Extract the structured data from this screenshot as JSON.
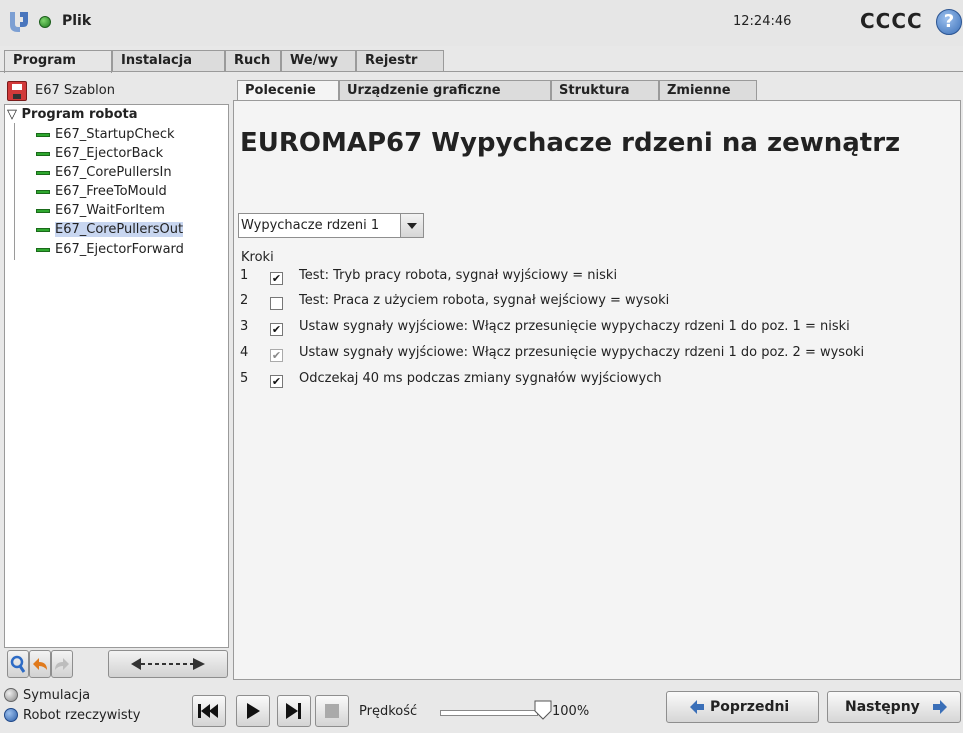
{
  "topbar": {
    "file_label": "Plik",
    "clock": "12:24:46",
    "robot_name": "CCCC",
    "help": "?"
  },
  "main_tabs": [
    {
      "label": "Program"
    },
    {
      "label": "Instalacja"
    },
    {
      "label": "Ruch"
    },
    {
      "label": "We/wy"
    },
    {
      "label": "Rejestr"
    }
  ],
  "sidebar": {
    "template_label": "E67 Szablon",
    "tree_root": "Program robota",
    "items": [
      {
        "label": "E67_StartupCheck"
      },
      {
        "label": "E67_EjectorBack"
      },
      {
        "label": "E67_CorePullersIn"
      },
      {
        "label": "E67_FreeToMould"
      },
      {
        "label": "E67_WaitForItem"
      },
      {
        "label": "E67_CorePullersOut"
      },
      {
        "label": "E67_EjectorForward"
      }
    ]
  },
  "sub_tabs": [
    {
      "label": "Polecenie"
    },
    {
      "label": "Urządzenie graficzne"
    },
    {
      "label": "Struktura"
    },
    {
      "label": "Zmienne"
    }
  ],
  "main": {
    "title": "EUROMAP67 Wypychacze rdzeni na zewnątrz",
    "dropdown_value": "Wypychacze rdzeni 1",
    "steps_label": "Kroki",
    "steps": [
      {
        "num": "1",
        "text": "Test: Tryb pracy robota, sygnał wyjściowy = niski",
        "checked": true
      },
      {
        "num": "2",
        "text": "Test: Praca z użyciem robota, sygnał wejściowy = wysoki",
        "checked": false
      },
      {
        "num": "3",
        "text": "Ustaw sygnały wyjściowe: Włącz przesunięcie wypychaczy rdzeni 1 do poz. 1 = niski",
        "checked": true
      },
      {
        "num": "4",
        "text": "Ustaw sygnały wyjściowe: Włącz przesunięcie wypychaczy rdzeni 1 do poz. 2 = wysoki",
        "checked": true
      },
      {
        "num": "5",
        "text": "Odczekaj 40 ms podczas zmiany sygnałów wyjściowych",
        "checked": true
      }
    ]
  },
  "bottom": {
    "sim_label": "Symulacja",
    "real_label": "Robot rzeczywisty",
    "speed_label": "Prędkość",
    "speed_value": "100%",
    "prev_label": "Poprzedni",
    "next_label": "Następny"
  },
  "colors": {
    "accent_blue": "#3a6fb8",
    "tree_dash": "#2fa82f",
    "nav_arrow": "#3a6fb8"
  }
}
